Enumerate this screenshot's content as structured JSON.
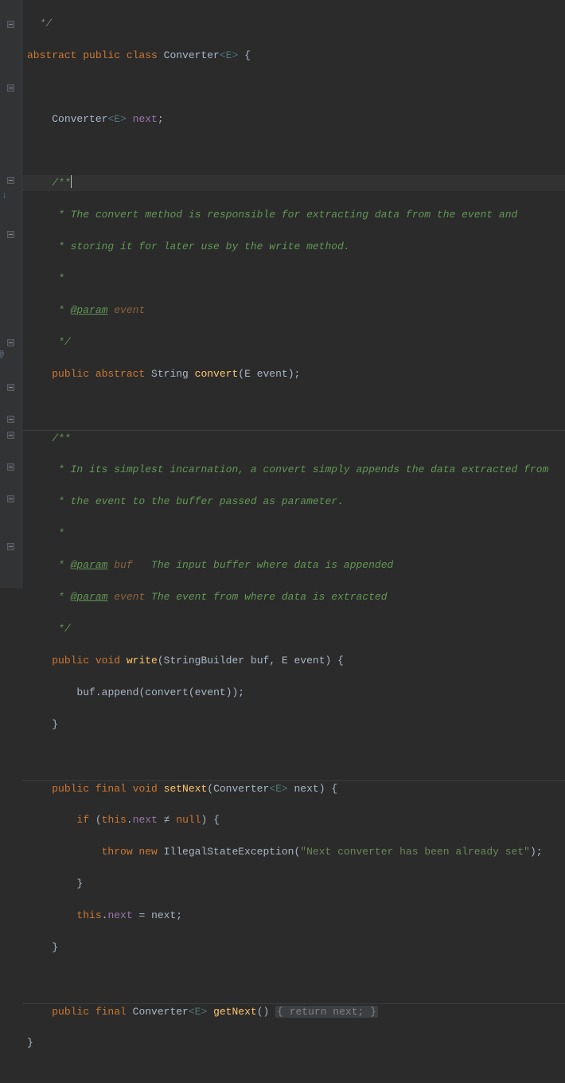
{
  "lines": {
    "l0": " */",
    "decl_abs": "abstract ",
    "decl_pub": "public ",
    "decl_cls": "class ",
    "decl_name": "Converter",
    "decl_gen": "<E> ",
    "decl_brace": "{",
    "fld_type": "Converter",
    "fld_gen": "<E> ",
    "fld_name": "next",
    "fld_semi": ";",
    "jd1_open": "/**",
    "jd1_l1": " * The convert method is responsible for extracting data from the event and",
    "jd1_l2": " * storing it for later use by the write method.",
    "jd1_l3": " *",
    "jd1_tag": "@param",
    "jd1_p": " event",
    "jd1_close": " */",
    "m1_pub": "public ",
    "m1_abs": "abstract ",
    "m1_ret": "String ",
    "m1_name": "convert",
    "m1_po": "(",
    "m1_pt": "E ",
    "m1_pn": "event",
    "m1_pc": ")",
    "m1_semi": ";",
    "jd2_open": "/**",
    "jd2_l1": " * In its simplest incarnation, a convert simply appends the data extracted from",
    "jd2_l2": " * the event to the buffer passed as parameter.",
    "jd2_l3": " *",
    "jd2_t1": "@param",
    "jd2_p1": " buf   ",
    "jd2_d1": "The input buffer where data is appended",
    "jd2_t2": "@param",
    "jd2_p2": " event ",
    "jd2_d2": "The event from where data is extracted",
    "jd2_close": " */",
    "m2_pub": "public ",
    "m2_void": "void ",
    "m2_name": "write",
    "m2_sig_a": "(StringBuilder ",
    "m2_sig_b": "buf",
    "m2_sig_c": ", ",
    "m2_sig_d": "E ",
    "m2_sig_e": "event",
    "m2_sig_f": ") {",
    "m2_body_a": "buf.",
    "m2_body_b": "append",
    "m2_body_c": "(",
    "m2_body_d": "convert",
    "m2_body_e": "(event));",
    "brace_close": "}",
    "m3_pub": "public ",
    "m3_final": "final ",
    "m3_void": "void ",
    "m3_name": "setNext",
    "m3_po": "(Converter",
    "m3_gen": "<E> ",
    "m3_pn": "next",
    "m3_pc": ") {",
    "m3_if": "if ",
    "m3_cond_a": "(",
    "m3_this": "this",
    "m3_dot": ".",
    "m3_fld": "next",
    "m3_neq": " ≠ ",
    "m3_null": "null",
    "m3_cond_b": ") {",
    "m3_throw": "throw new ",
    "m3_exc": "IllegalStateException",
    "m3_po2": "(",
    "m3_str": "\"Next converter has been already set\"",
    "m3_pc2": ");",
    "m3_as_a": "this",
    "m3_as_b": ".",
    "m3_as_c": "next",
    "m3_as_d": " = next;",
    "m4_pub": "public ",
    "m4_final": "final ",
    "m4_ret": "Converter",
    "m4_gen": "<E> ",
    "m4_name": "getNext",
    "m4_sig": "() ",
    "m4_fold": "{ return next; }"
  }
}
